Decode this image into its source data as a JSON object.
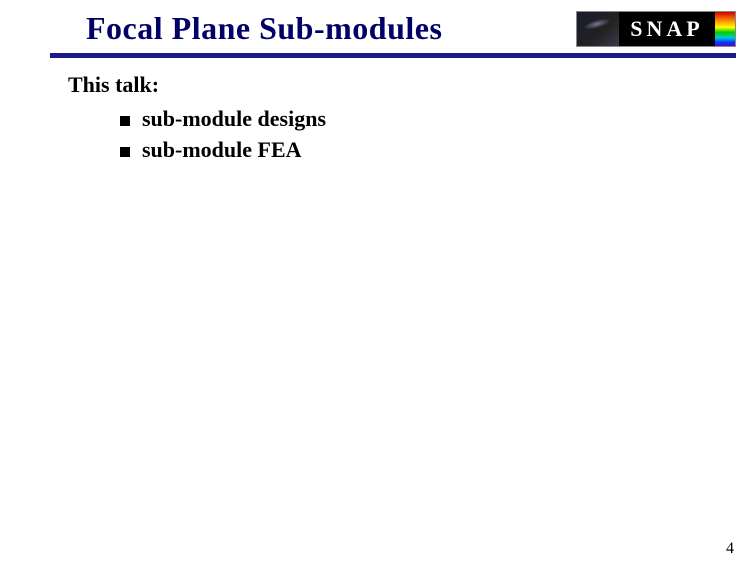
{
  "header": {
    "title": "Focal Plane Sub-modules",
    "logo_text": "SNAP"
  },
  "content": {
    "intro": "This talk:",
    "bullets": [
      "sub-module designs",
      "sub-module FEA"
    ]
  },
  "footer": {
    "page_number": "4"
  }
}
